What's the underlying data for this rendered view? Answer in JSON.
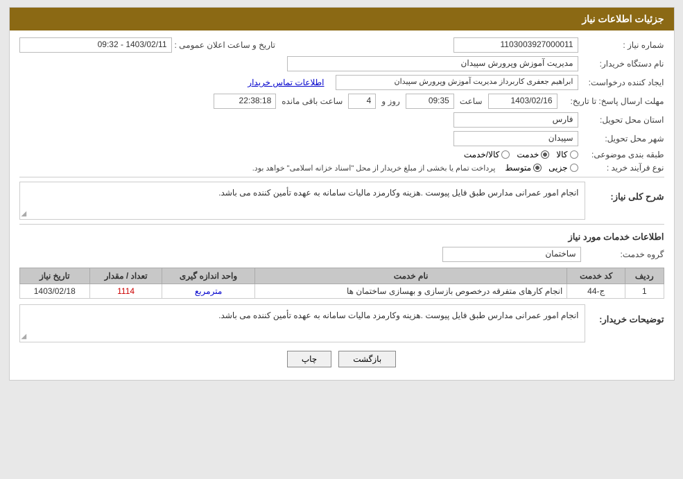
{
  "header": {
    "title": "جزئیات اطلاعات نیاز"
  },
  "fields": {
    "need_number_label": "شماره نیاز :",
    "need_number_value": "1103003927000011",
    "buyer_name_label": "نام دستگاه خریدار:",
    "buyer_name_value": "مدیریت آموزش وپرورش سپیدان",
    "requester_label": "ایجاد کننده درخواست:",
    "requester_value": "ابراهیم جعفری کاربرداز مدیریت آموزش وپرورش سپیدان",
    "contact_link": "اطلاعات تماس خریدار",
    "deadline_label": "مهلت ارسال پاسخ: تا تاریخ:",
    "deadline_date": "1403/02/16",
    "deadline_time_label": "ساعت",
    "deadline_time": "09:35",
    "days_label": "روز و",
    "days_value": "4",
    "remaining_label": "ساعت باقی مانده",
    "remaining_time": "22:38:18",
    "delivery_province_label": "استان محل تحویل:",
    "delivery_province_value": "فارس",
    "delivery_city_label": "شهر محل تحویل:",
    "delivery_city_value": "سپیدان",
    "category_label": "طبقه بندی موضوعی:",
    "category_options": [
      "کالا",
      "خدمت",
      "کالا/خدمت"
    ],
    "category_selected": "خدمت",
    "purchase_type_label": "نوع فرآیند خرید :",
    "purchase_type_options": [
      "جزیی",
      "متوسط"
    ],
    "purchase_type_selected": "متوسط",
    "purchase_note": "پرداخت تمام یا بخشی از مبلغ خریدار از محل \"اسناد خزانه اسلامی\" خواهد بود.",
    "general_description_title": "شرح کلی نیاز:",
    "general_description_value": "انجام امور عمرانی مدارس طبق فایل پیوست .هزینه وکارمزد مالیات سامانه به عهده تأمین کننده می باشد.",
    "services_title": "اطلاعات خدمات مورد نیاز",
    "service_group_label": "گروه خدمت:",
    "service_group_value": "ساختمان",
    "table": {
      "headers": [
        "ردیف",
        "کد خدمت",
        "نام خدمت",
        "واحد اندازه گیری",
        "تعداد / مقدار",
        "تاریخ نیاز"
      ],
      "rows": [
        {
          "row": "1",
          "code": "ج-44",
          "name": "انجام کارهای متفرقه درخصوص بازسازی و بهسازی ساختمان ها",
          "unit": "مترمربع",
          "quantity": "1114",
          "date": "1403/02/18"
        }
      ]
    },
    "buyer_desc_label": "توضیحات خریدار:",
    "buyer_desc_value": "انجام امور عمرانی مدارس طبق فایل پیوست .هزینه وکارمزد مالیات سامانه به عهده تأمین کننده می باشد.",
    "buttons": {
      "print": "چاپ",
      "back": "بازگشت"
    }
  }
}
